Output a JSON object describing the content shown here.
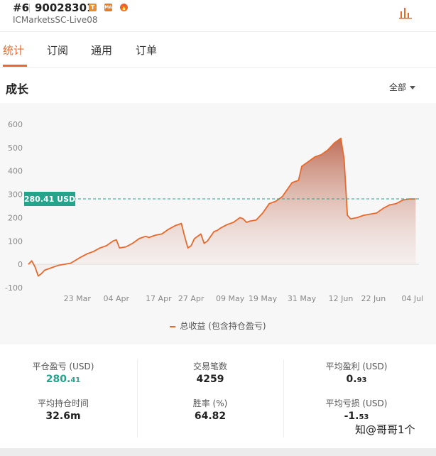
{
  "header": {
    "rank": "#6",
    "account_id": "90028301",
    "server": "ICMarketsSC-Live08",
    "badges": [
      "T",
      "MA",
      "🔥"
    ]
  },
  "tabs": [
    {
      "label": "统计",
      "active": true
    },
    {
      "label": "订阅",
      "active": false
    },
    {
      "label": "通用",
      "active": false
    },
    {
      "label": "订单",
      "active": false
    }
  ],
  "section": {
    "title": "成长",
    "range_label": "全部"
  },
  "chart_data": {
    "type": "area",
    "ylim": [
      -100,
      600
    ],
    "yticks": [
      "600",
      "500",
      "400",
      "300",
      "200",
      "100",
      "0",
      "-100"
    ],
    "xticks": [
      "23 Mar",
      "04 Apr",
      "17 Apr",
      "27 Apr",
      "09 May",
      "19 May",
      "31 May",
      "12 Jun",
      "22 Jun",
      "04 Jul"
    ],
    "current_value": 280.41,
    "current_label": "280.41 USD",
    "series": [
      {
        "name": "总收益 (包含持仓盈亏)",
        "color": "#e8692c",
        "x": [
          "03-08",
          "03-09",
          "03-10",
          "03-11",
          "03-12",
          "03-13",
          "03-15",
          "03-17",
          "03-19",
          "03-21",
          "03-24",
          "03-26",
          "03-28",
          "03-30",
          "04-01",
          "04-03",
          "04-04",
          "04-05",
          "04-07",
          "04-09",
          "04-11",
          "04-13",
          "04-14",
          "04-16",
          "04-18",
          "04-20",
          "04-22",
          "04-24",
          "04-25",
          "04-26",
          "04-27",
          "04-28",
          "04-30",
          "05-01",
          "05-02",
          "05-04",
          "05-05",
          "05-06",
          "05-08",
          "05-10",
          "05-12",
          "05-13",
          "05-14",
          "05-15",
          "05-17",
          "05-19",
          "05-21",
          "05-23",
          "05-25",
          "05-26",
          "05-28",
          "05-30",
          "05-31",
          "06-02",
          "06-04",
          "06-06",
          "06-08",
          "06-10",
          "06-12",
          "06-13",
          "06-14",
          "06-15",
          "06-17",
          "06-19",
          "06-21",
          "06-23",
          "06-25",
          "06-27",
          "06-29",
          "07-01",
          "07-03",
          "07-05"
        ],
        "values": [
          0,
          15,
          -10,
          -50,
          -40,
          -25,
          -15,
          -5,
          0,
          5,
          30,
          45,
          55,
          70,
          80,
          100,
          105,
          70,
          75,
          90,
          110,
          120,
          115,
          125,
          130,
          150,
          165,
          175,
          120,
          70,
          80,
          110,
          130,
          90,
          100,
          140,
          145,
          155,
          170,
          180,
          200,
          195,
          180,
          185,
          190,
          220,
          260,
          270,
          290,
          310,
          350,
          360,
          420,
          440,
          460,
          470,
          490,
          520,
          540,
          450,
          210,
          195,
          200,
          210,
          215,
          220,
          240,
          255,
          260,
          275,
          280,
          280
        ]
      }
    ]
  },
  "stats": [
    {
      "label": "平仓盈亏 (USD)",
      "value_main": "280.",
      "value_small": "41",
      "color": "#25a38b"
    },
    {
      "label": "交易笔数",
      "value_main": "4259",
      "value_small": ""
    },
    {
      "label": "平均盈利 (USD)",
      "value_main": "0.",
      "value_small": "93"
    },
    {
      "label": "平均持仓时间",
      "value_main": "32.6m",
      "value_small": ""
    },
    {
      "label": "胜率 (%)",
      "value_main": "64.82",
      "value_small": ""
    },
    {
      "label": "平均亏损 (USD)",
      "value_main": "-1.",
      "value_small": "53"
    }
  ],
  "watermark": "知@哥哥1个"
}
